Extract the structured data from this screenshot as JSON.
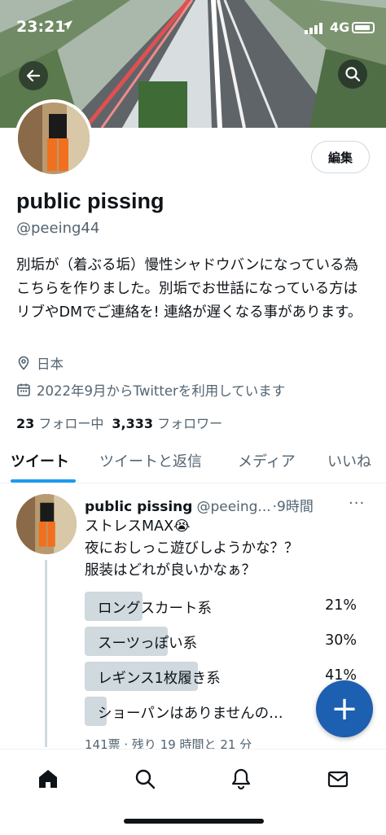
{
  "status_bar": {
    "time": "23:21",
    "network": "4G"
  },
  "profile": {
    "display_name": "public pissing",
    "handle": "@peeing44",
    "edit_label": "編集",
    "bio": "別垢が（着ぶる垢）慢性シャドウバンになっている為こちらを作りました。別垢でお世話になっている方はリブやDMでご連絡を! 連絡が遅くなる事があります。",
    "location": "日本",
    "joined": "2022年9月からTwitterを利用しています",
    "following_count": "23",
    "following_label": "フォロー中",
    "followers_count": "3,333",
    "followers_label": "フォロワー"
  },
  "tabs": [
    {
      "label": "ツイート",
      "active": true
    },
    {
      "label": "ツイートと返信",
      "active": false
    },
    {
      "label": "メディア",
      "active": false
    },
    {
      "label": "いいね",
      "active": false
    }
  ],
  "tweet": {
    "name": "public pissing",
    "handle": "@peeing...",
    "time": "·9時間",
    "more": "···",
    "lines": [
      "ストレスMAX😭",
      "夜におしっこ遊びしようかな？？",
      "服装はどれが良いかなぁ？"
    ],
    "poll": [
      {
        "label": "ロングスカート系",
        "percent": "21%",
        "fraction": 0.21
      },
      {
        "label": "スーツっぽい系",
        "percent": "30%",
        "fraction": 0.3
      },
      {
        "label": "レギンス1枚履き系",
        "percent": "41%",
        "fraction": 0.41
      },
      {
        "label": "ショーパンはありませんの…",
        "percent": "",
        "fraction": 0.08
      }
    ],
    "poll_meta": "141票 · 残り 19 時間と 21 分"
  },
  "fab": {
    "label": "+"
  },
  "icons": {
    "back": "arrow-left-icon",
    "search": "search-icon",
    "location": "location-pin-icon",
    "calendar": "calendar-icon",
    "home": "home-icon",
    "explore": "search-icon",
    "notifications": "bell-icon",
    "messages": "envelope-icon"
  },
  "colors": {
    "accent": "#1d9bf0",
    "fab": "#1d5fb0",
    "poll_fill": "#cfd9de",
    "muted": "#536471"
  }
}
